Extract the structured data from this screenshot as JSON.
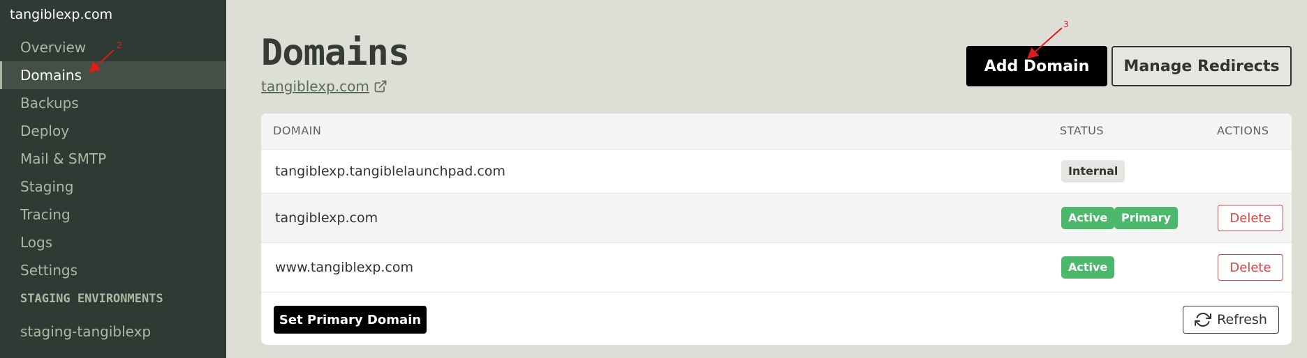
{
  "sidebar": {
    "site_name": "tangiblexp.com",
    "items": [
      {
        "label": "Overview"
      },
      {
        "label": "Domains"
      },
      {
        "label": "Backups"
      },
      {
        "label": "Deploy"
      },
      {
        "label": "Mail & SMTP"
      },
      {
        "label": "Staging"
      },
      {
        "label": "Tracing"
      },
      {
        "label": "Logs"
      },
      {
        "label": "Settings"
      }
    ],
    "section_label": "STAGING ENVIRONMENTS",
    "staging_items": [
      {
        "label": "staging-tangiblexp"
      }
    ],
    "active_item": "Domains"
  },
  "header": {
    "title": "Domains",
    "site_link": "tangiblexp.com",
    "add_button": "Add Domain",
    "redirects_button": "Manage Redirects"
  },
  "table": {
    "columns": [
      "DOMAIN",
      "STATUS",
      "ACTIONS"
    ],
    "rows": [
      {
        "domain": "tangiblexp.tangiblelaunchpad.com",
        "badges": [
          "Internal"
        ],
        "action": ""
      },
      {
        "domain": "tangiblexp.com",
        "badges": [
          "Active",
          "Primary"
        ],
        "action": "Delete"
      },
      {
        "domain": "www.tangiblexp.com",
        "badges": [
          "Active"
        ],
        "action": "Delete"
      }
    ],
    "set_primary_button": "Set Primary Domain",
    "refresh_button": "Refresh"
  },
  "annotations": {
    "marker_2": "2",
    "marker_3": "3"
  },
  "colors": {
    "sidebar_bg": "#2e3a33",
    "main_bg": "#dddfd6",
    "active_badge": "#4cb86c",
    "delete_red": "#d64545",
    "annotation_red": "#e01b1b"
  }
}
